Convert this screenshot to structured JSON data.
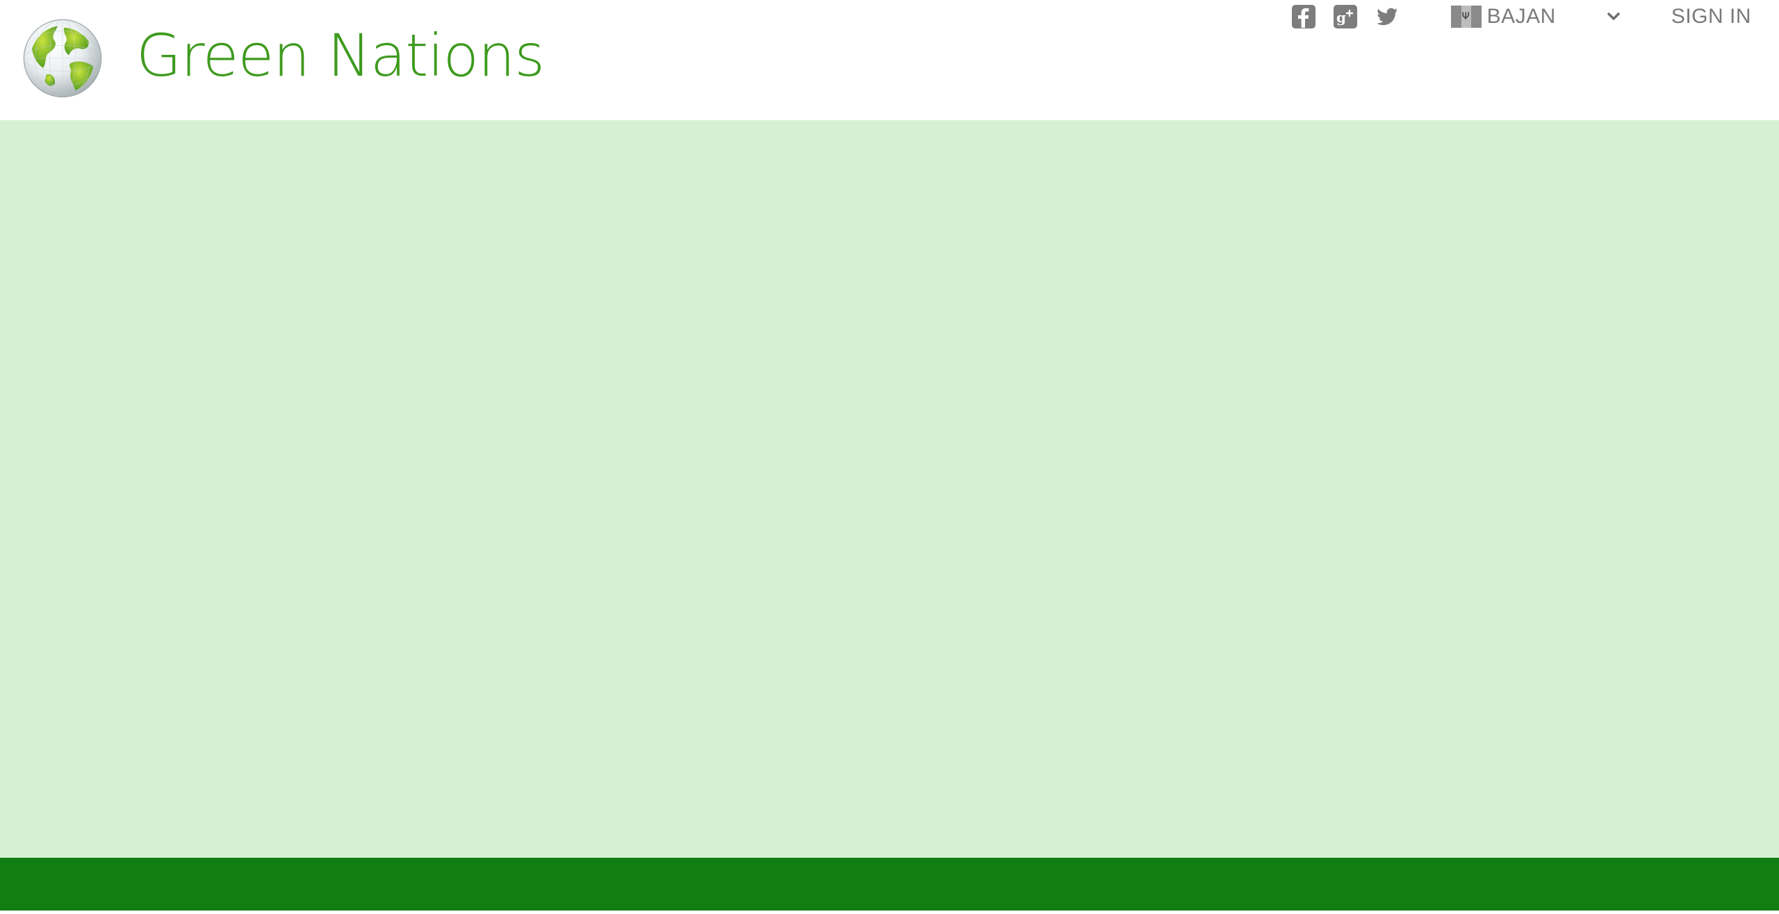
{
  "brand": {
    "name": "Green Nations",
    "color": "#3e9a1e"
  },
  "social": [
    {
      "name": "facebook",
      "icon": "facebook-icon"
    },
    {
      "name": "google-plus",
      "icon": "google-plus-icon"
    },
    {
      "name": "twitter",
      "icon": "twitter-icon"
    }
  ],
  "language": {
    "selected": "BAJAN",
    "flag_icon": "barbados-flag-icon"
  },
  "auth": {
    "signin_label": "SIGN IN"
  },
  "colors": {
    "main_background": "#d4f2d3",
    "footer_bar": "#107e12",
    "text_gray": "#7a7a7a"
  }
}
